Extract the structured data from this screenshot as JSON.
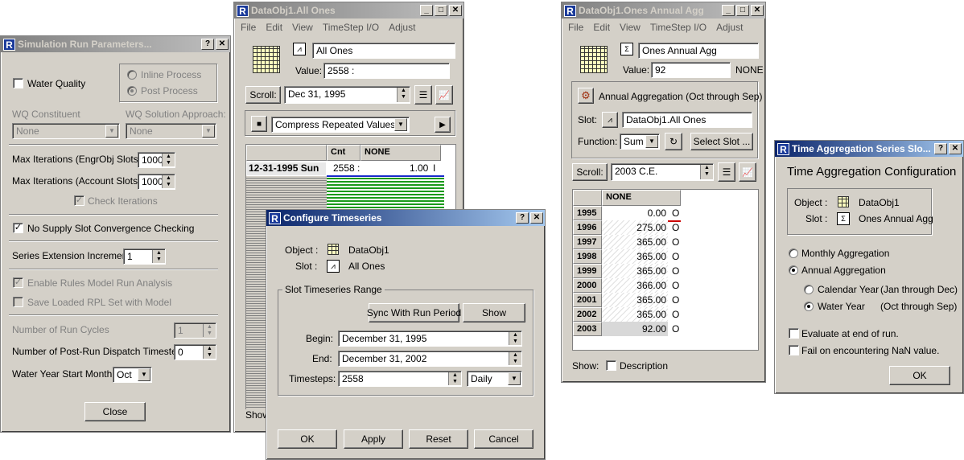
{
  "simrun": {
    "title": "Simulation Run Parameters...",
    "water_quality": "Water Quality",
    "inline_process": "Inline Process",
    "post_process": "Post Process",
    "wq_constituent": "WQ Constituent",
    "wq_solution": "WQ Solution Approach:",
    "none1": "None",
    "none2": "None",
    "max_iter_engr": "Max Iterations  (EngrObj Slots)",
    "max_iter_engr_val": "1000",
    "max_iter_acct": "Max Iterations (Account Slots)",
    "max_iter_acct_val": "1000",
    "check_iterations": "Check Iterations",
    "no_supply": "No Supply Slot Convergence Checking",
    "series_ext": "Series Extension Increment",
    "series_ext_val": "1",
    "enable_rules": "Enable Rules Model Run Analysis",
    "save_rpl": "Save Loaded RPL Set with Model",
    "num_cycles": "Number of Run Cycles",
    "num_cycles_val": "1",
    "num_postrun": "Number of Post-Run Dispatch Timesteps",
    "num_postrun_val": "0",
    "wy_start": "Water Year Start Month:",
    "wy_start_val": "Oct",
    "close": "Close"
  },
  "allones": {
    "title": "DataObj1.All Ones",
    "menu": [
      "File",
      "Edit",
      "View",
      "TimeStep I/O",
      "Adjust"
    ],
    "slot_name": "All Ones",
    "value_label": "Value:",
    "value": "2558 :",
    "scroll": "Scroll:",
    "scroll_date": "Dec 31, 1995",
    "compress": "Compress Repeated Values",
    "col_cnt": "Cnt",
    "col_none": "NONE",
    "row_date": "12-31-1995 Sun",
    "row_cnt": "2558 :",
    "row_val": "1.00",
    "row_flag": "I",
    "show": "Show"
  },
  "config": {
    "title": "Configure Timeseries",
    "object_label": "Object :",
    "object": "DataObj1",
    "slot_label": "Slot :",
    "slot": "All Ones",
    "range_group": "Slot Timeseries Range",
    "sync": "Sync With Run Period",
    "show": "Show",
    "begin_label": "Begin:",
    "begin": "December 31, 1995",
    "end_label": "End:",
    "end": "December 31, 2002",
    "timesteps_label": "Timesteps:",
    "timesteps": "2558",
    "step": "Daily",
    "ok": "OK",
    "apply": "Apply",
    "reset": "Reset",
    "cancel": "Cancel"
  },
  "annual": {
    "title": "DataObj1.Ones Annual Agg",
    "menu": [
      "File",
      "Edit",
      "View",
      "TimeStep I/O",
      "Adjust"
    ],
    "slot_name": "Ones Annual Agg",
    "value_label": "Value:",
    "value": "92",
    "unit": "NONE",
    "agg_title": "Annual Aggregation (Oct through Sep)",
    "slot_label": "Slot:",
    "slot": "DataObj1.All Ones",
    "function_label": "Function:",
    "function": "Sum",
    "select_slot": "Select Slot ...",
    "scroll": "Scroll:",
    "scroll_val": "2003 C.E.",
    "col_none": "NONE",
    "rows": [
      {
        "year": "1995",
        "val": "0.00",
        "flag": "O"
      },
      {
        "year": "1996",
        "val": "275.00",
        "flag": "O"
      },
      {
        "year": "1997",
        "val": "365.00",
        "flag": "O"
      },
      {
        "year": "1998",
        "val": "365.00",
        "flag": "O"
      },
      {
        "year": "1999",
        "val": "365.00",
        "flag": "O"
      },
      {
        "year": "2000",
        "val": "366.00",
        "flag": "O"
      },
      {
        "year": "2001",
        "val": "365.00",
        "flag": "O"
      },
      {
        "year": "2002",
        "val": "365.00",
        "flag": "O"
      },
      {
        "year": "2003",
        "val": "92.00",
        "flag": "O"
      }
    ],
    "show": "Show:",
    "description": "Description"
  },
  "tagg": {
    "title": "Time Aggregation Series Slo...",
    "heading": "Time Aggregation Configuration",
    "object_label": "Object :",
    "object": "DataObj1",
    "slot_label": "Slot :",
    "slot": "Ones Annual Agg",
    "monthly": "Monthly Aggregation",
    "annual": "Annual Aggregation",
    "calendar": "Calendar Year",
    "calendar_range": "(Jan through Dec)",
    "water": "Water Year",
    "water_range": "(Oct through Sep)",
    "evaluate": "Evaluate at end of run.",
    "fail_nan": "Fail on encountering NaN value.",
    "ok": "OK"
  }
}
